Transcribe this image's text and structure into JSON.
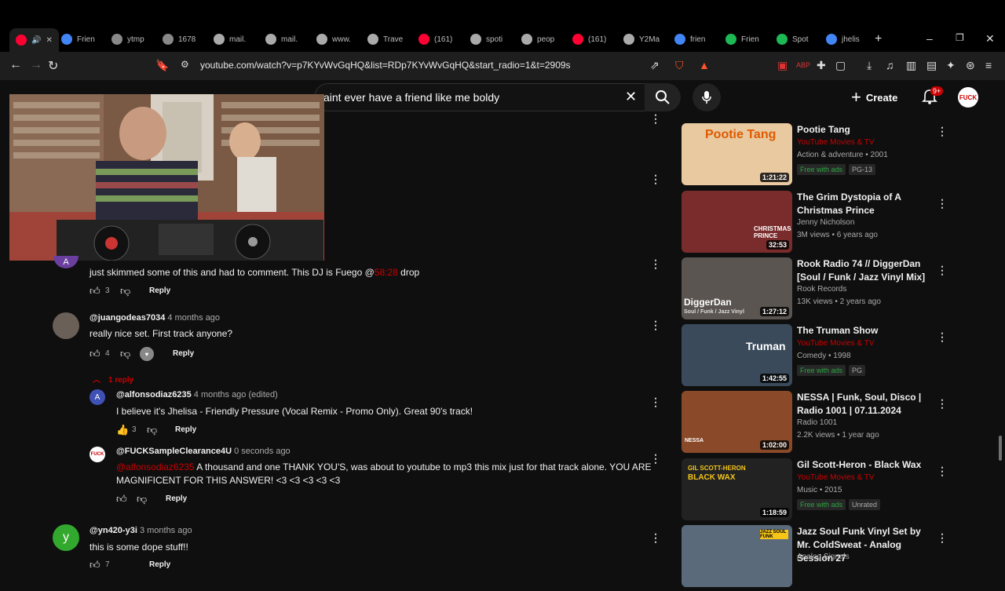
{
  "tabs": [
    {
      "label": "",
      "color": "#ff0033",
      "active": true
    },
    {
      "label": "Frien",
      "color": "#4285f4"
    },
    {
      "label": "ytmp",
      "color": "#888888"
    },
    {
      "label": "1678",
      "color": "#888888"
    },
    {
      "label": "mail.",
      "color": "#aaaaaa"
    },
    {
      "label": "mail.",
      "color": "#aaaaaa"
    },
    {
      "label": "www.",
      "color": "#aaaaaa"
    },
    {
      "label": "Trave",
      "color": "#aaaaaa"
    },
    {
      "label": "(161)",
      "color": "#ff0033"
    },
    {
      "label": "spoti",
      "color": "#aaaaaa"
    },
    {
      "label": "peop",
      "color": "#aaaaaa"
    },
    {
      "label": "(161)",
      "color": "#ff0033"
    },
    {
      "label": "Y2Ma",
      "color": "#aaaaaa"
    },
    {
      "label": "frien",
      "color": "#4285f4"
    },
    {
      "label": "Frien",
      "color": "#1db954"
    },
    {
      "label": "Spot",
      "color": "#1db954"
    },
    {
      "label": "jhelis",
      "color": "#4285f4"
    }
  ],
  "address": {
    "url": "youtube.com/watch?v=p7KYvWvGqHQ&list=RDp7KYvWvGqHQ&start_radio=1&t=2909s"
  },
  "header": {
    "search_value": "aint ever have a friend like me boldy",
    "create_label": "Create",
    "notif_count": "9+",
    "avatar_text": "FUCK"
  },
  "comments": [
    {
      "handle": "",
      "time": "",
      "text_before": "just skimmed some of this and had to comment. This DJ is Fuego @",
      "timestamp": "58:28",
      "text_after": " drop",
      "likes": "3",
      "reply": "Reply"
    },
    {
      "handle": "@juangodeas7034",
      "time": "4 months ago",
      "text": "really nice set. First track anyone?",
      "likes": "4",
      "reply": "Reply",
      "replies_toggle": "1 reply"
    },
    {
      "handle": "@alfonsodiaz6235",
      "time": "4 months ago (edited)",
      "text": "I believe it's Jhelisa - Friendly Pressure (Vocal Remix - Promo Only). Great 90's track!",
      "likes": "3",
      "reply": "Reply"
    },
    {
      "handle": "@FUCKSampleClearance4U",
      "time": "0 seconds ago",
      "mention": "@alfonsodiaz6235",
      "text_l1": "  A thousand and one THANK YOU'S, was about to youtube to mp3 this mix just for that track alone. YOU ARE",
      "text_l2": "MAGNIFICENT FOR THIS ANSWER! <3 <3 <3 <3 <3",
      "reply": "Reply"
    },
    {
      "handle": "@yn420-y3i",
      "time": "3 months ago",
      "text": "this is some dope stuff!!",
      "avatar_letter": "y",
      "likes": "7",
      "reply": "Reply"
    }
  ],
  "sidebar": [
    {
      "title": "Pootie Tang",
      "l2": "YouTube Movies & TV",
      "l3": "Action & adventure • 2001",
      "chips": [
        "Free with ads",
        "PG-13"
      ],
      "duration": "1:21:22",
      "thumb": "#e8c9a0"
    },
    {
      "title": "The Grim Dystopia of A Christmas Prince",
      "l2": "Jenny Nicholson",
      "l3": "3M views • 6 years ago",
      "duration": "32:53",
      "thumb": "#7a2b2b"
    },
    {
      "title": "Rook Radio 74 // DiggerDan [Soul / Funk / Jazz Vinyl Mix]",
      "l2": "Rook Records",
      "l3": "13K views • 2 years ago",
      "duration": "1:27:12",
      "thumb": "#5a5550"
    },
    {
      "title": "The Truman Show",
      "l2": "YouTube Movies & TV",
      "l3": "Comedy • 1998",
      "chips": [
        "Free with ads",
        "PG"
      ],
      "duration": "1:42:55",
      "thumb": "#3a4a5a"
    },
    {
      "title": "NESSA | Funk, Soul, Disco | Radio 1001 | 07.11.2024",
      "l2": "Radio 1001",
      "l3": "2.2K views • 1 year ago",
      "duration": "1:02:00",
      "thumb": "#8a4a2a"
    },
    {
      "title": "Gil Scott-Heron - Black Wax",
      "l2": "YouTube Movies & TV",
      "l3": "Music • 2015",
      "chips": [
        "Free with ads",
        "Unrated"
      ],
      "duration": "1:18:59",
      "thumb": "#222222"
    },
    {
      "title": "Jazz Soul Funk Vinyl Set by Mr. ColdSweat - Analog Session 27",
      "l2": "Analog Signals",
      "l3": "",
      "duration": "",
      "thumb": "#5a6a7a"
    }
  ],
  "thumb_overlays": {
    "christmas": "CHRISTMAS PRINCE",
    "digger": "DiggerDan",
    "digger_sub": "Soul / Funk / Jazz Vinyl",
    "truman": "Truman",
    "nessa": "NESSA",
    "gil": "GIL SCOTT-HERON",
    "gil2": "BLACK WAX",
    "jazz": "JAZZ SOUL FUNK"
  }
}
